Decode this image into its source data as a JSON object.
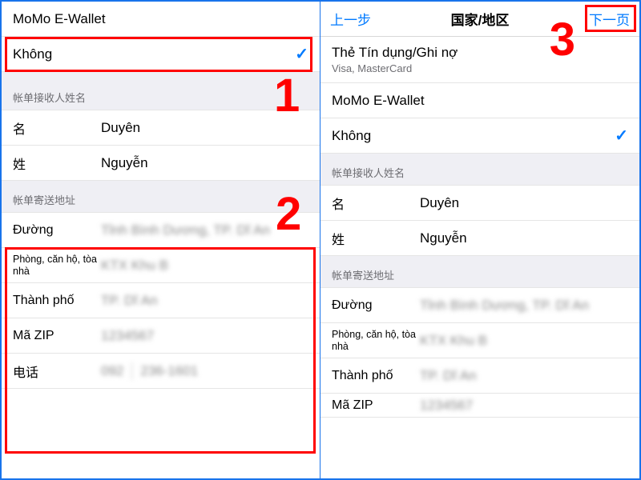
{
  "left": {
    "payment": {
      "momo": "MoMo E-Wallet",
      "none": "Không"
    },
    "section_name": "帐单接收人姓名",
    "name_row": {
      "label": "名",
      "value": "Duyên"
    },
    "surname_row": {
      "label": "姓",
      "value": "Nguyễn"
    },
    "section_addr": "帐单寄送地址",
    "street": {
      "label": "Đường",
      "value": "Tỉnh Bình Dương, TP. Dĩ An"
    },
    "apt": {
      "label": "Phòng, căn hộ, tòa nhà",
      "value": "KTX Khu B"
    },
    "city": {
      "label": "Thành phố",
      "value": "TP. Dĩ An"
    },
    "zip": {
      "label": "Mã ZIP",
      "value": "1234567"
    },
    "phone": {
      "label": "电话",
      "cc": "092",
      "num": "236-1601"
    }
  },
  "right": {
    "nav": {
      "back": "上一步",
      "title": "国家/地区",
      "next": "下一页"
    },
    "payment": {
      "card": "Thẻ Tín dụng/Ghi nợ",
      "card_sub": "Visa, MasterCard",
      "momo": "MoMo E-Wallet",
      "none": "Không"
    },
    "section_name": "帐单接收人姓名",
    "name_row": {
      "label": "名",
      "value": "Duyên"
    },
    "surname_row": {
      "label": "姓",
      "value": "Nguyễn"
    },
    "section_addr": "帐单寄送地址",
    "street": {
      "label": "Đường",
      "value": "Tỉnh Bình Dương, TP. Dĩ An"
    },
    "apt": {
      "label": "Phòng, căn hộ, tòa nhà",
      "value": "KTX Khu B"
    },
    "city": {
      "label": "Thành phố",
      "value": "TP. Dĩ An"
    },
    "zip": {
      "label": "Mã ZIP",
      "value": "1234567"
    }
  },
  "anno": {
    "n1": "1",
    "n2": "2",
    "n3": "3"
  }
}
